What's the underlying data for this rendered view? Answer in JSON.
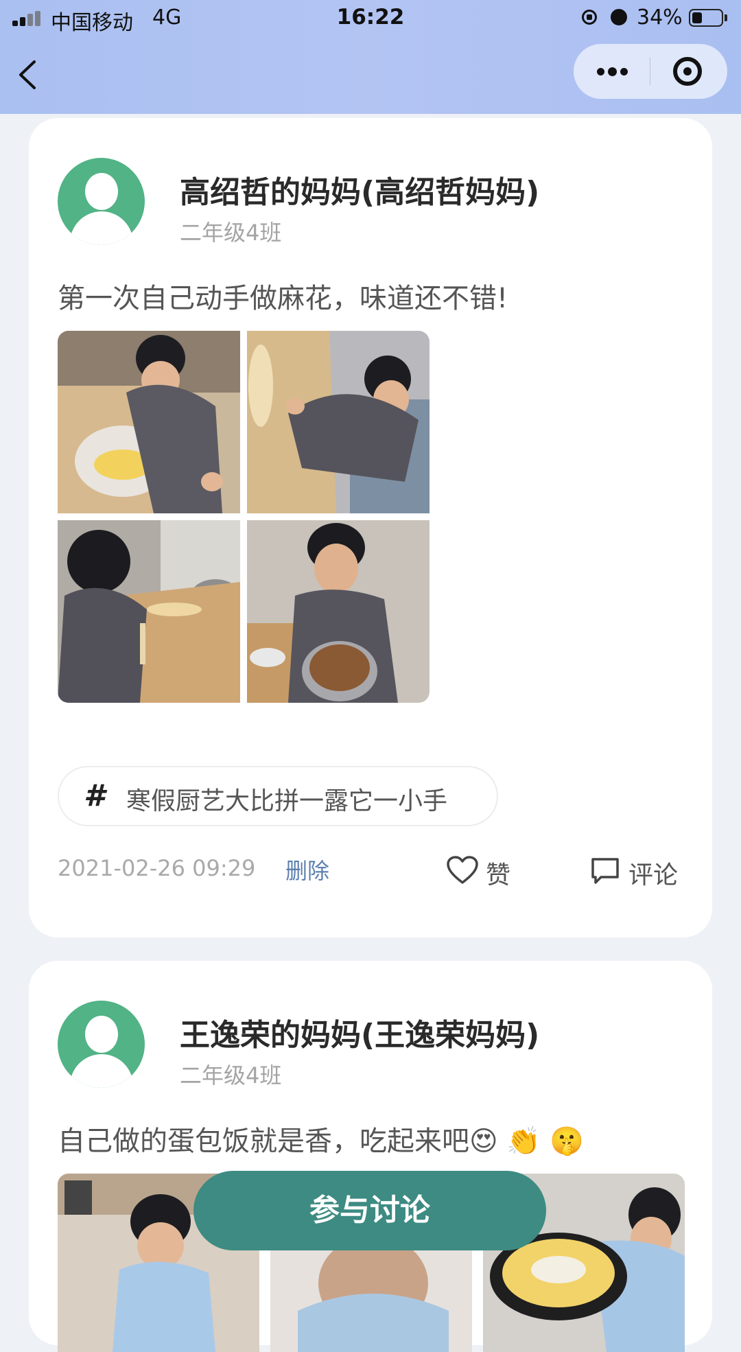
{
  "status_bar": {
    "carrier": "中国移动",
    "network": "4G",
    "time": "16:22",
    "battery": "34%",
    "battery_level": 0.34
  },
  "nav": {
    "back_icon": "chevron-left-icon",
    "more_icon": "more-dots-icon",
    "close_icon": "mini-program-close-icon"
  },
  "posts": [
    {
      "author": "高绍哲的妈妈(高绍哲妈妈)",
      "class_name": "二年级4班",
      "text": "第一次自己动手做麻花，味道还不错!",
      "topic": "寒假厨艺大比拼一露它一小手",
      "date": "2021-02-26 09:29",
      "delete": "删除",
      "like": "赞",
      "comment": "评论",
      "photo_count": 4
    },
    {
      "author": "王逸荣的妈妈(王逸荣妈妈)",
      "class_name": "二年级4班",
      "text": "自己做的蛋包饭就是香，吃起来吧",
      "emojis": [
        "😍",
        "👏",
        "🤫"
      ],
      "photo_count": 3
    }
  ],
  "join_button": "参与讨论",
  "colors": {
    "header_gradient": "#aac0f1",
    "avatar_green": "#51b386",
    "join_button_bg": "#3d8b82",
    "delete_link": "#5b7fae",
    "page_bg": "#eef1f6"
  }
}
